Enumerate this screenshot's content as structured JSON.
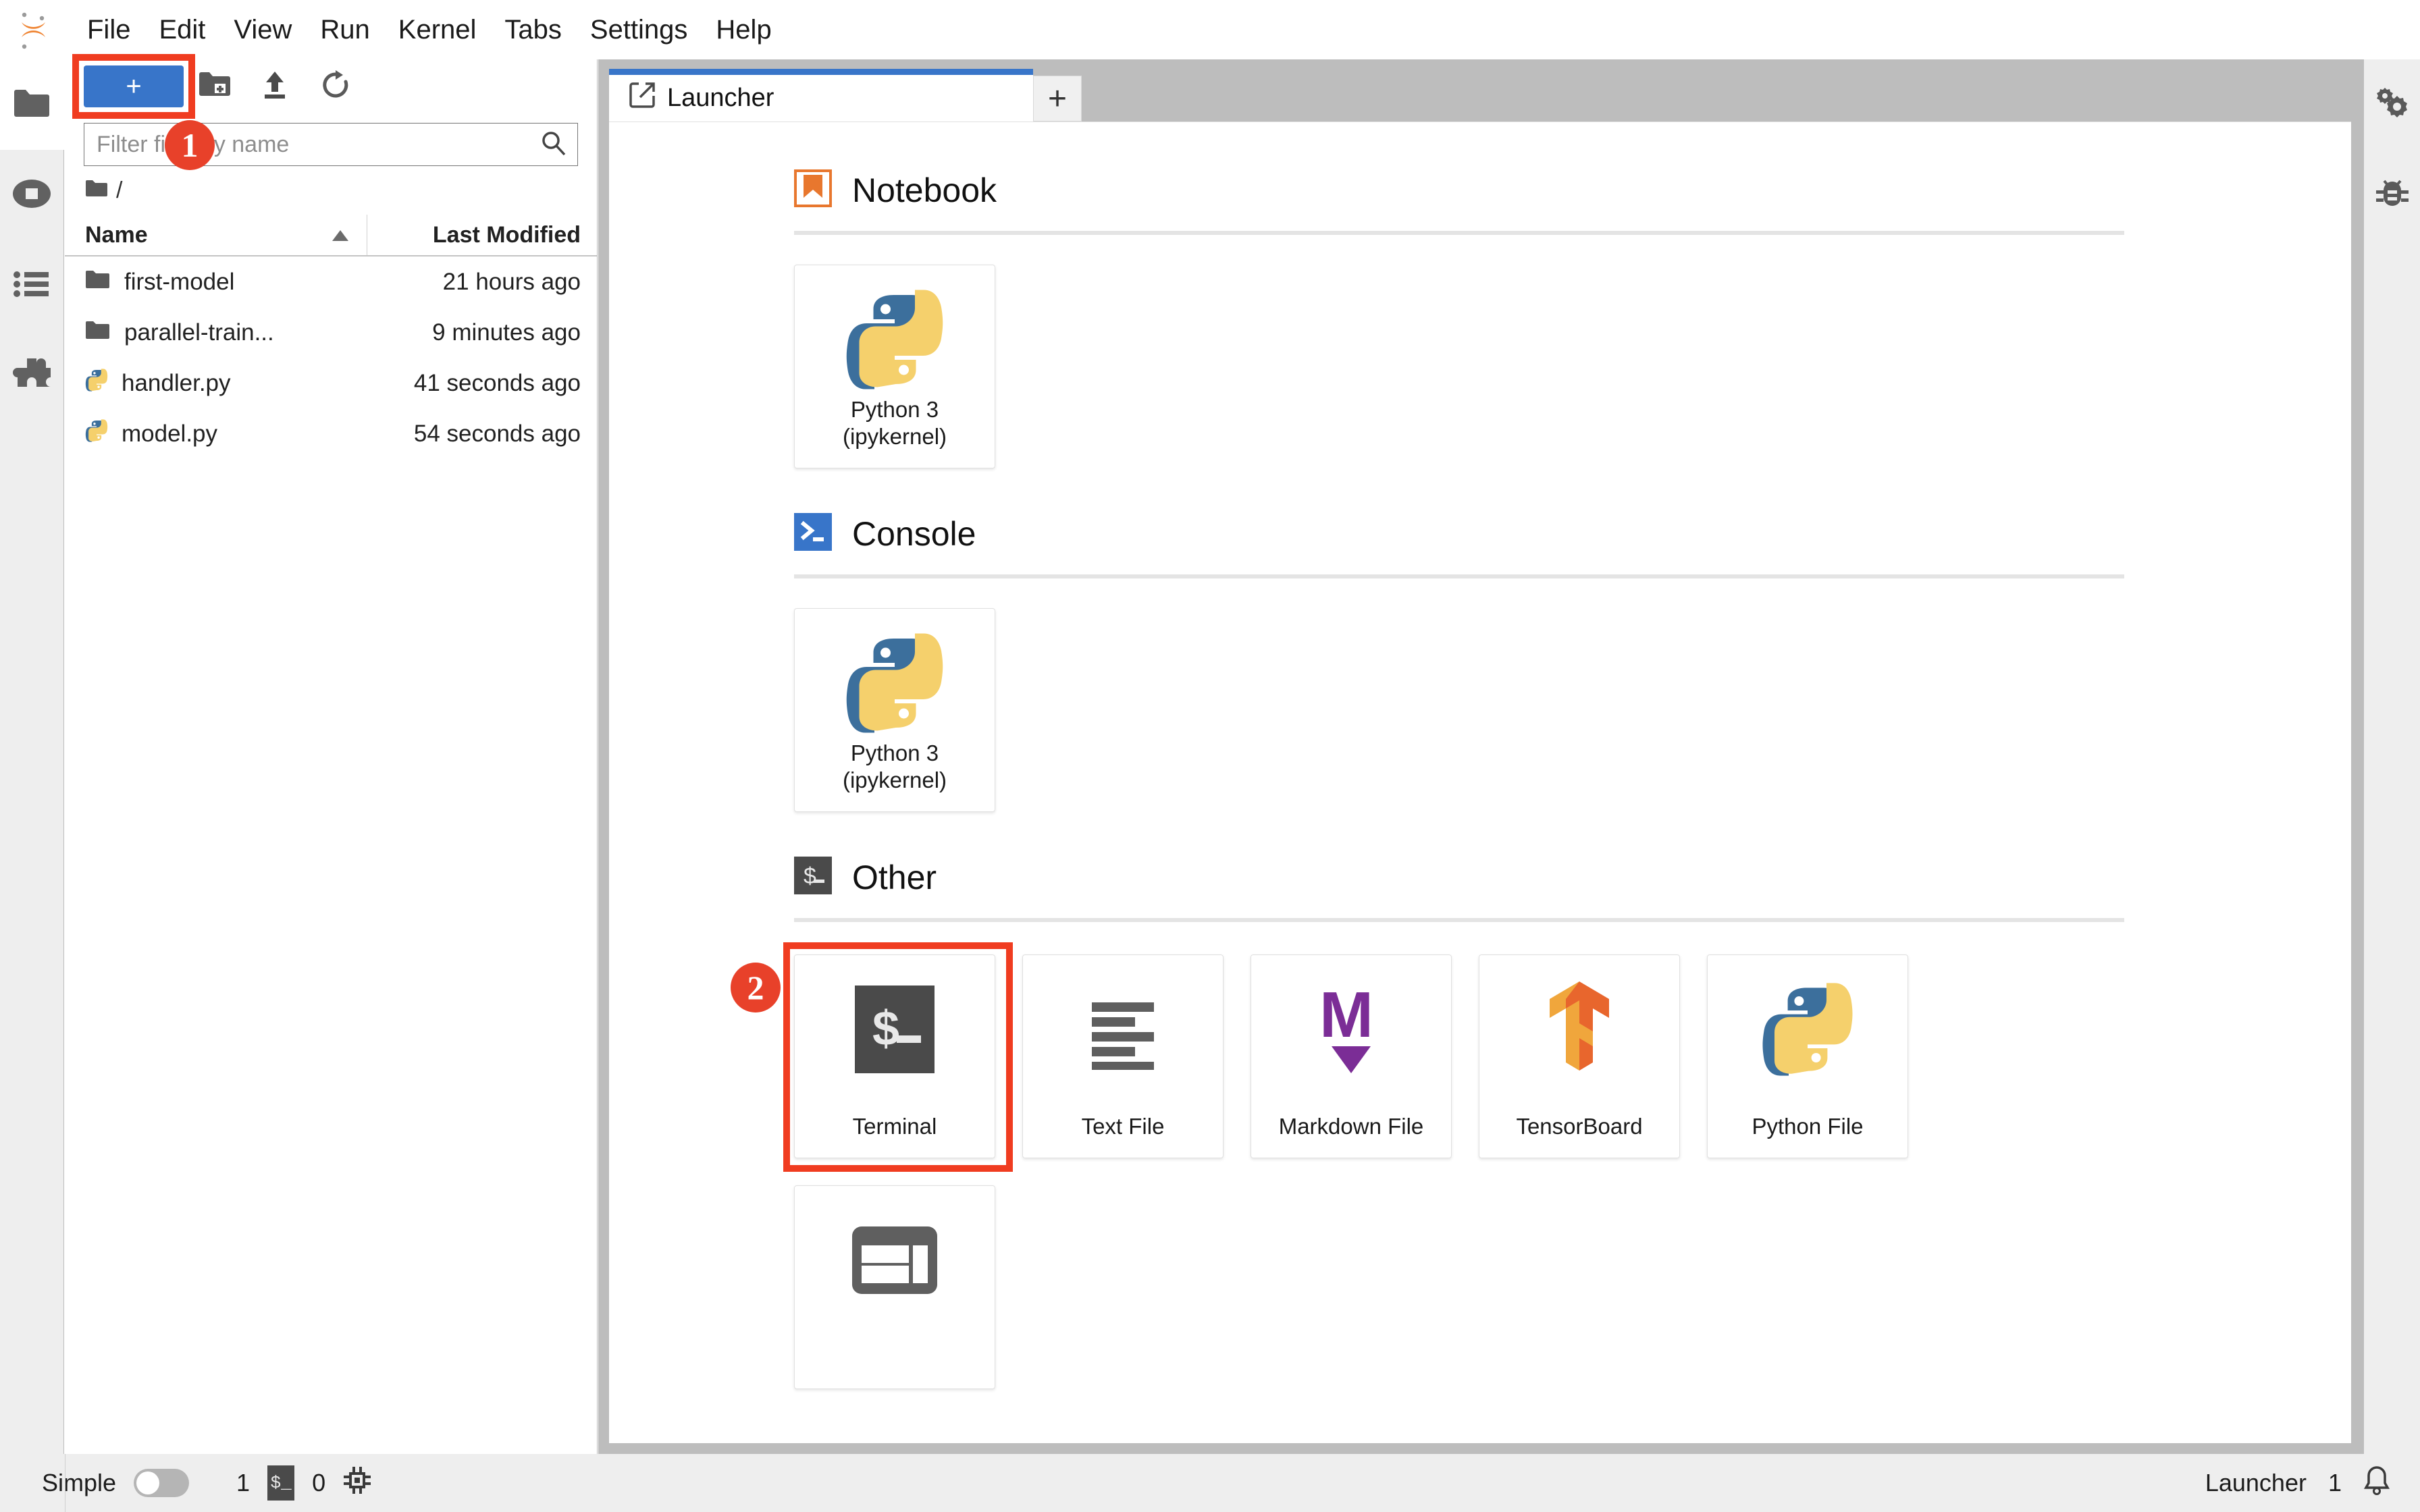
{
  "app": {
    "logo_icon": "jupyter-logo-icon",
    "menu": [
      {
        "label": "File"
      },
      {
        "label": "Edit"
      },
      {
        "label": "View"
      },
      {
        "label": "Run"
      },
      {
        "label": "Kernel"
      },
      {
        "label": "Tabs"
      },
      {
        "label": "Settings"
      },
      {
        "label": "Help"
      }
    ]
  },
  "colors": {
    "accent_blue": "#3875c9",
    "highlight_red": "#f03c20",
    "badge_red": "#e8412a",
    "panel_gray": "#bdbdbd",
    "sidebar_gray": "#eeeeee",
    "notebook_orange": "#e8772e",
    "terminal_dark": "#4a4a4a",
    "markdown_purple": "#7b2d96"
  },
  "activitybar_left": [
    {
      "name": "file-browser",
      "icon": "folder-icon",
      "active": true
    },
    {
      "name": "running-terminals-kernels",
      "icon": "stop-circle-icon",
      "active": false
    },
    {
      "name": "table-of-contents",
      "icon": "list-icon",
      "active": false
    },
    {
      "name": "extension-manager",
      "icon": "puzzle-icon",
      "active": false
    }
  ],
  "activitybar_right": [
    {
      "name": "property-inspector",
      "icon": "gears-icon"
    },
    {
      "name": "debugger",
      "icon": "bug-icon"
    }
  ],
  "file_browser": {
    "toolbar": {
      "new_launcher_label": "+",
      "new_launcher_name": "new-launcher-button",
      "new_folder_icon": "new-folder-icon",
      "upload_icon": "upload-icon",
      "refresh_icon": "refresh-icon"
    },
    "filter": {
      "placeholder": "Filter files by name",
      "value": "",
      "icon": "search-icon"
    },
    "breadcrumb": {
      "root_icon": "folder-icon",
      "path": "/"
    },
    "columns": {
      "name": "Name",
      "last_modified": "Last Modified",
      "sort_indicator": "sort-ascending-icon"
    },
    "rows": [
      {
        "icon": "folder-icon",
        "name": "first-model",
        "modified": "21 hours ago"
      },
      {
        "icon": "folder-icon",
        "name": "parallel-train...",
        "modified": "9 minutes ago"
      },
      {
        "icon": "python-file-icon",
        "name": "handler.py",
        "modified": "41 seconds ago"
      },
      {
        "icon": "python-file-icon",
        "name": "model.py",
        "modified": "54 seconds ago"
      }
    ]
  },
  "dock": {
    "tabs": [
      {
        "label": "Launcher",
        "icon": "launcher-icon",
        "active": true
      }
    ],
    "new_tab_label": "+"
  },
  "launcher": {
    "sections": [
      {
        "title": "Notebook",
        "icon": "notebook-bookmark-icon",
        "cards": [
          {
            "label": "Python 3\n(ipykernel)",
            "line1": "Python 3",
            "line2": "(ipykernel)",
            "icon": "python-logo-icon"
          }
        ]
      },
      {
        "title": "Console",
        "icon": "console-prompt-icon",
        "cards": [
          {
            "label": "Python 3\n(ipykernel)",
            "line1": "Python 3",
            "line2": "(ipykernel)",
            "icon": "python-logo-icon"
          }
        ]
      },
      {
        "title": "Other",
        "icon": "terminal-dollar-icon",
        "cards": [
          {
            "label": "Terminal",
            "line1": "Terminal",
            "line2": "",
            "icon": "terminal-dollar-icon"
          },
          {
            "label": "Text File",
            "line1": "Text File",
            "line2": "",
            "icon": "text-lines-icon"
          },
          {
            "label": "Markdown File",
            "line1": "Markdown File",
            "line2": "",
            "icon": "markdown-m-icon"
          },
          {
            "label": "TensorBoard",
            "line1": "TensorBoard",
            "line2": "",
            "icon": "tensorboard-icon"
          },
          {
            "label": "Python File",
            "line1": "Python File",
            "line2": "",
            "icon": "python-logo-icon"
          }
        ],
        "extra_cards": [
          {
            "label": "",
            "line1": "",
            "line2": "",
            "icon": "contextual-help-panel-icon"
          }
        ]
      }
    ]
  },
  "annotations": [
    {
      "number": "1",
      "target": "new-launcher-button"
    },
    {
      "number": "2",
      "target": "terminal-card"
    }
  ],
  "statusbar": {
    "mode_label": "Simple",
    "mode_toggle_on": false,
    "kernel_count": "1",
    "terminal_icon": "terminal-dollar-icon",
    "terminal_count": "0",
    "cpu_icon": "cpu-chip-icon",
    "active_widget": "Launcher",
    "notification_count": "1",
    "notification_icon": "bell-icon"
  }
}
